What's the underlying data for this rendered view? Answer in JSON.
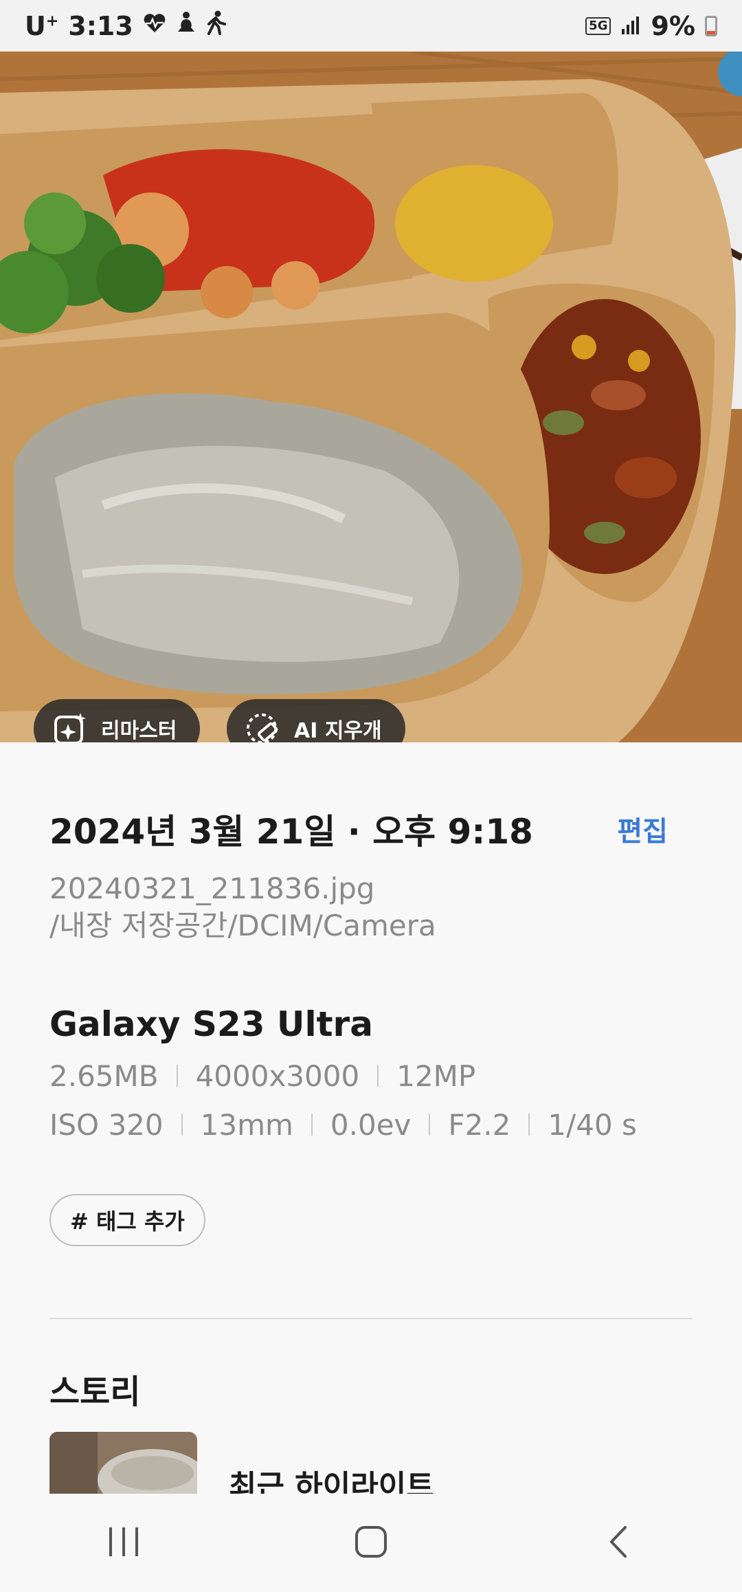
{
  "status_bar": {
    "carrier": "U",
    "carrier_sup": "+",
    "time": "3:13",
    "network": "5G",
    "battery": "9%",
    "battery_level": 0.09
  },
  "photo": {
    "remaster_label": "리마스터",
    "ai_eraser_label": "AI 지우개"
  },
  "details": {
    "date": "2024년 3월 21일 · 오후 9:18",
    "edit_label": "편집",
    "filename": "20240321_211836.jpg",
    "path": "/내장 저장공간/DCIM/Camera",
    "device": "Galaxy S23 Ultra",
    "specs_row1": [
      "2.65MB",
      "4000x3000",
      "12MP"
    ],
    "specs_row2": [
      "ISO 320",
      "13mm",
      "0.0ev",
      "F2.2",
      "1/40 s"
    ],
    "tag_button": "# 태그 추가"
  },
  "story": {
    "title": "스토리",
    "item_label": "최근 하이라이트"
  },
  "colors": {
    "accent": "#3a7bd5",
    "battery_low": "#e05a3a"
  }
}
